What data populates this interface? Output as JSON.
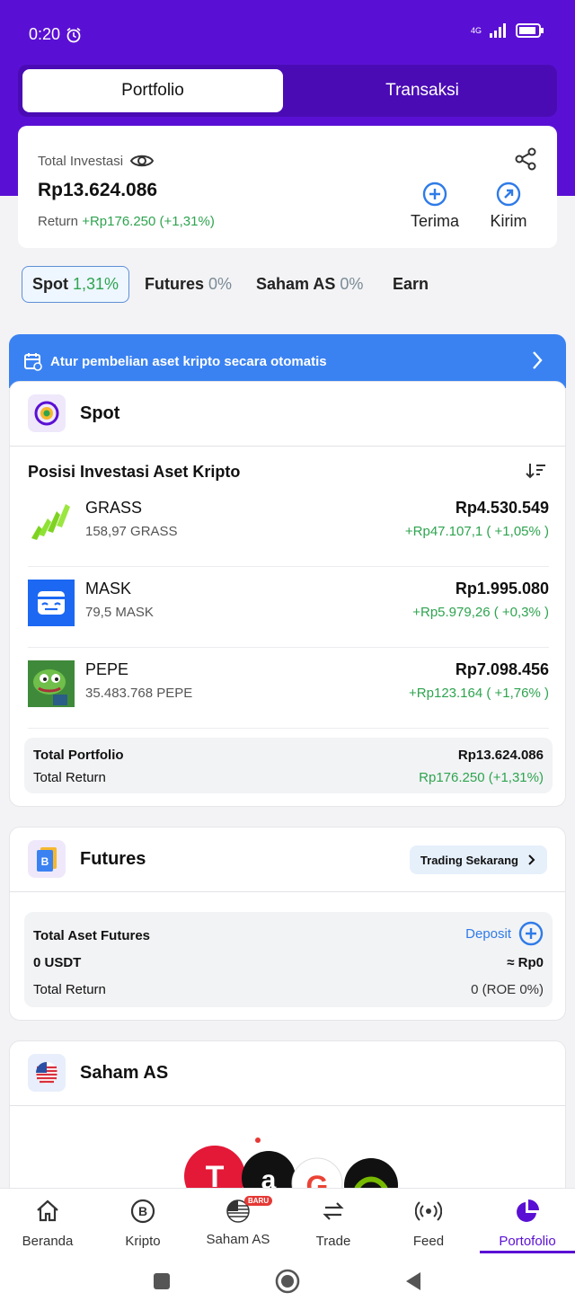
{
  "status": {
    "time": "0:20",
    "network": "4G"
  },
  "tabs": {
    "portfolio": "Portfolio",
    "transaksi": "Transaksi"
  },
  "summary": {
    "label": "Total Investasi",
    "value": "Rp13.624.086",
    "return_label": "Return",
    "return_value": "+Rp176.250 (+1,31%)",
    "terima": "Terima",
    "kirim": "Kirim"
  },
  "filters": [
    {
      "name": "Spot",
      "value": "1,31%"
    },
    {
      "name": "Futures",
      "value": "0%"
    },
    {
      "name": "Saham AS",
      "value": "0%"
    },
    {
      "name": "Earn",
      "value": ""
    }
  ],
  "banner": {
    "text": "Atur pembelian aset kripto secara otomatis"
  },
  "spot": {
    "title": "Spot",
    "positions_title": "Posisi Investasi Aset Kripto",
    "assets": [
      {
        "name": "GRASS",
        "qty": "158,97 GRASS",
        "value": "Rp4.530.549",
        "return": "+Rp47.107,1 ( +1,05% )"
      },
      {
        "name": "MASK",
        "qty": "79,5 MASK",
        "value": "Rp1.995.080",
        "return": "+Rp5.979,26 ( +0,3% )"
      },
      {
        "name": "PEPE",
        "qty": "35.483.768 PEPE",
        "value": "Rp7.098.456",
        "return": "+Rp123.164 ( +1,76% )"
      }
    ],
    "total_portfolio_label": "Total Portfolio",
    "total_portfolio_value": "Rp13.624.086",
    "total_return_label": "Total Return",
    "total_return_value": "Rp176.250 (+1,31%)"
  },
  "futures": {
    "title": "Futures",
    "trade_button": "Trading Sekarang",
    "total_label": "Total Aset Futures",
    "deposit": "Deposit",
    "usdt": "0 USDT",
    "approx": "≈ Rp0",
    "return_label": "Total Return",
    "return_value": "0 (ROE 0%)"
  },
  "saham": {
    "title": "Saham AS"
  },
  "nav": [
    {
      "label": "Beranda",
      "icon": "home-icon"
    },
    {
      "label": "Kripto",
      "icon": "bitcoin-icon"
    },
    {
      "label": "Saham AS",
      "icon": "us-flag-icon",
      "badge": "BARU"
    },
    {
      "label": "Trade",
      "icon": "swap-icon"
    },
    {
      "label": "Feed",
      "icon": "broadcast-icon"
    },
    {
      "label": "Portofolio",
      "icon": "pie-chart-icon"
    }
  ],
  "colors": {
    "brand": "#5a10d4",
    "accent": "#3a82f2",
    "positive": "#2ea44f"
  }
}
